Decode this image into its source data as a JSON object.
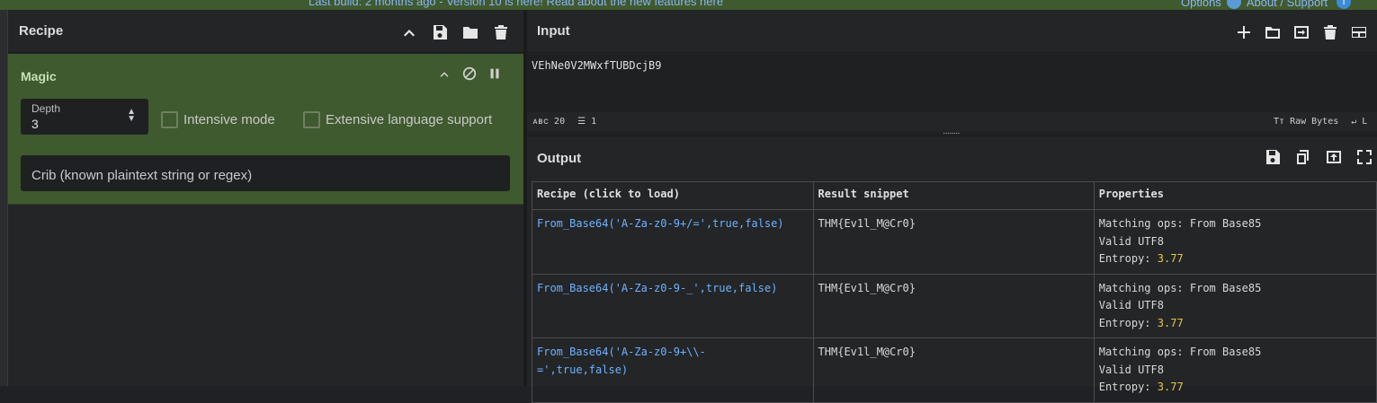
{
  "topbar": {
    "banner_text": "Last build: 2 months ago - Version 10 is here! Read about the new features here",
    "options_label": "Options",
    "about_label": "About / Support"
  },
  "recipe_panel": {
    "title": "Recipe",
    "operation": {
      "title": "Magic",
      "depth_label": "Depth",
      "depth_value": "3",
      "intensive_mode_label": "Intensive mode",
      "intensive_mode_checked": false,
      "extensive_language_label": "Extensive language support",
      "extensive_language_checked": false,
      "crib_placeholder": "Crib (known plaintext string or regex)"
    }
  },
  "input_panel": {
    "title": "Input",
    "value": "VEhNe0V2MWxfTUBDcjB9",
    "status": {
      "length_label": "20",
      "lines_label": "1",
      "format_label": "Raw Bytes"
    }
  },
  "output_panel": {
    "title": "Output",
    "table": {
      "headers": [
        "Recipe (click to load)",
        "Result snippet",
        "Properties"
      ],
      "rows": [
        {
          "recipe": "From_Base64('A-Za-z0-9+/=',true,false)",
          "snippet": "THM{Ev1l_M@Cr0}",
          "prop_matching": "Matching ops: From Base85",
          "prop_valid": "Valid UTF8",
          "prop_entropy_label": "Entropy: ",
          "prop_entropy_value": "3.77"
        },
        {
          "recipe": "From_Base64('A-Za-z0-9-_',true,false)",
          "snippet": "THM{Ev1l_M@Cr0}",
          "prop_matching": "Matching ops: From Base85",
          "prop_valid": "Valid UTF8",
          "prop_entropy_label": "Entropy: ",
          "prop_entropy_value": "3.77"
        },
        {
          "recipe_line1": "From_Base64('A-Za-z0-9+\\\\-",
          "recipe_line2": "=',true,false)",
          "snippet": "THM{Ev1l_M@Cr0}",
          "prop_matching": "Matching ops: From Base85",
          "prop_valid": "Valid UTF8",
          "prop_entropy_label": "Entropy: ",
          "prop_entropy_value": "3.77"
        }
      ]
    }
  },
  "colors": {
    "operation_bg": "#3f5a2e",
    "link": "#6fb1ff",
    "entropy": "#e6c54a",
    "panel_bg": "#232527"
  }
}
